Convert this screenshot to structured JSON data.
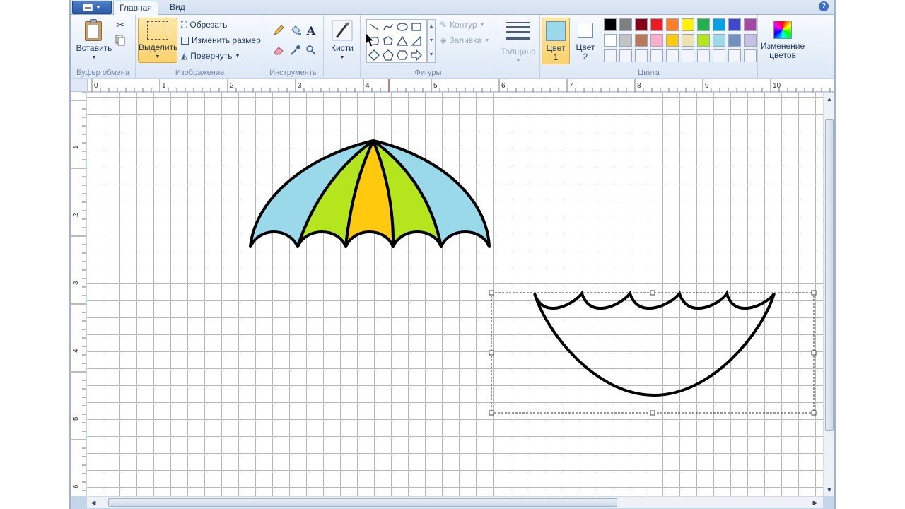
{
  "tabs": {
    "home": "Главная",
    "view": "Вид",
    "help": "?"
  },
  "clipboard": {
    "paste": "Вставить",
    "label": "Буфер обмена"
  },
  "image": {
    "select": "Выделить",
    "crop": "Обрезать",
    "resize": "Изменить размер",
    "rotate": "Повернуть",
    "label": "Изображение"
  },
  "tools": {
    "label": "Инструменты",
    "text_tool": "A"
  },
  "brushes": {
    "label": "Кисти"
  },
  "shapes": {
    "outline": "Контур",
    "fill": "Заливка",
    "label": "Фигуры"
  },
  "size": {
    "label": "Толщина"
  },
  "colors": {
    "color1_label": "Цвет",
    "color1_num": "1",
    "color2_label": "Цвет",
    "color2_num": "2",
    "edit_colors_line1": "Изменение",
    "edit_colors_line2": "цветов",
    "label": "Цвета",
    "color1_value": "#99d9ea",
    "color2_value": "#ffffff",
    "palette_row1": [
      "#000000",
      "#7f7f7f",
      "#880015",
      "#ed1c24",
      "#ff7f27",
      "#fff200",
      "#22b14c",
      "#00a2e8",
      "#3f48cc",
      "#a349a4"
    ],
    "palette_row2": [
      "#ffffff",
      "#c3c3c3",
      "#b97a57",
      "#ffaec9",
      "#ffc90e",
      "#efe4b0",
      "#b5e61d",
      "#99d9ea",
      "#7092be",
      "#c8bfe7"
    ]
  },
  "ruler": {
    "top": [
      "0",
      "1",
      "2",
      "3",
      "4",
      "5",
      "6",
      "7",
      "8",
      "9",
      "10"
    ],
    "left": [
      "1",
      "2",
      "3",
      "4",
      "5",
      "6"
    ]
  },
  "drawing": {
    "umbrella_colors": [
      "#99d9ea",
      "#b5e61d",
      "#ffc90e",
      "#b5e61d",
      "#99d9ea"
    ],
    "stroke": "#000000"
  }
}
